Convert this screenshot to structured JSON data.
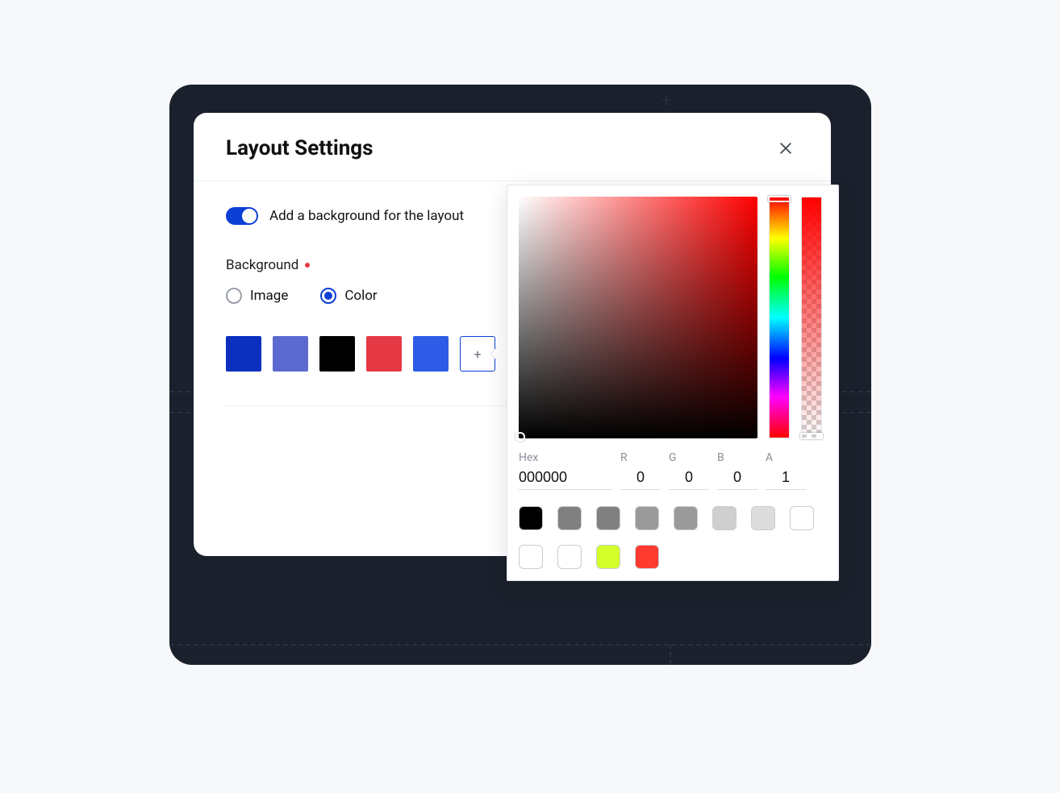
{
  "dialog": {
    "title": "Layout Settings",
    "toggle_label": "Add a background for the layout",
    "toggle_on": true,
    "background_label": "Background",
    "required": true,
    "radio_image": "Image",
    "radio_color": "Color",
    "selected_radio": "Color",
    "preset_swatches": [
      "#0b2fbf",
      "#5b6ad0",
      "#000000",
      "#e63946",
      "#2e5ce6"
    ],
    "add_swatch_icon": "+"
  },
  "picker": {
    "hue_base": "#ff0000",
    "labels": {
      "hex": "Hex",
      "r": "R",
      "g": "G",
      "b": "B",
      "a": "A"
    },
    "values": {
      "hex": "000000",
      "r": "0",
      "g": "0",
      "b": "0",
      "a": "1"
    },
    "swatches": [
      "#000000",
      "#808080",
      "#808080",
      "#9a9a9a",
      "#9a9a9a",
      "#cfcfcf",
      "#dcdcdc",
      "#ffffff",
      "#ffffff",
      "#ffffff",
      "#d4ff2a",
      "#ff3b2f"
    ]
  }
}
